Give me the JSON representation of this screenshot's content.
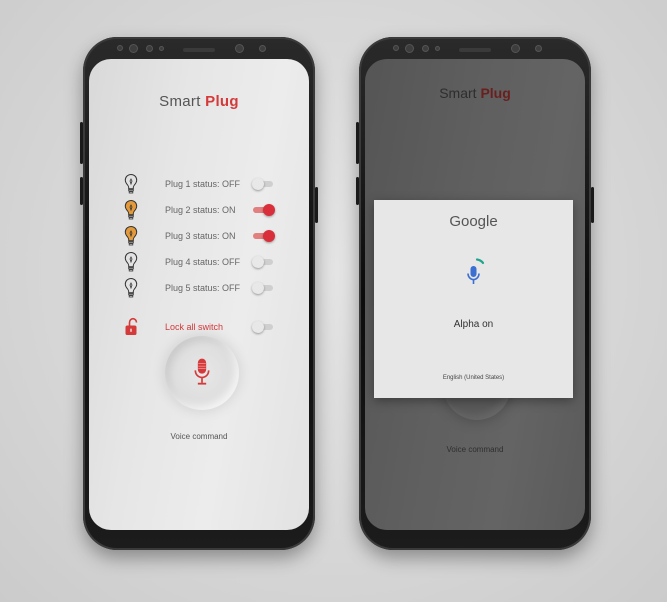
{
  "app": {
    "title_prefix": "Smart",
    "title_accent": "Plug",
    "accent_color": "#d43a3a"
  },
  "plugs": [
    {
      "label": "Plug 1 status: OFF",
      "state": "off",
      "icon": "lightbulb-off-icon"
    },
    {
      "label": "Plug 2 status: ON",
      "state": "on",
      "icon": "lightbulb-on-icon"
    },
    {
      "label": "Plug 3 status: ON",
      "state": "on",
      "icon": "lightbulb-on-icon"
    },
    {
      "label": "Plug 4 status: OFF",
      "state": "off",
      "icon": "lightbulb-off-icon"
    },
    {
      "label": "Plug 5 status: OFF",
      "state": "off",
      "icon": "lightbulb-off-icon"
    }
  ],
  "lock": {
    "label": "Lock all switch",
    "state": "off",
    "icon": "unlock-icon"
  },
  "voice": {
    "label": "Voice command",
    "icon": "microphone-icon"
  },
  "assistant": {
    "brand": "Google",
    "phrase": "Alpha on",
    "language": "English (United States)",
    "icon": "microphone-icon",
    "mic_color": "#3b6fd1",
    "wave_color": "#1fa58e"
  }
}
